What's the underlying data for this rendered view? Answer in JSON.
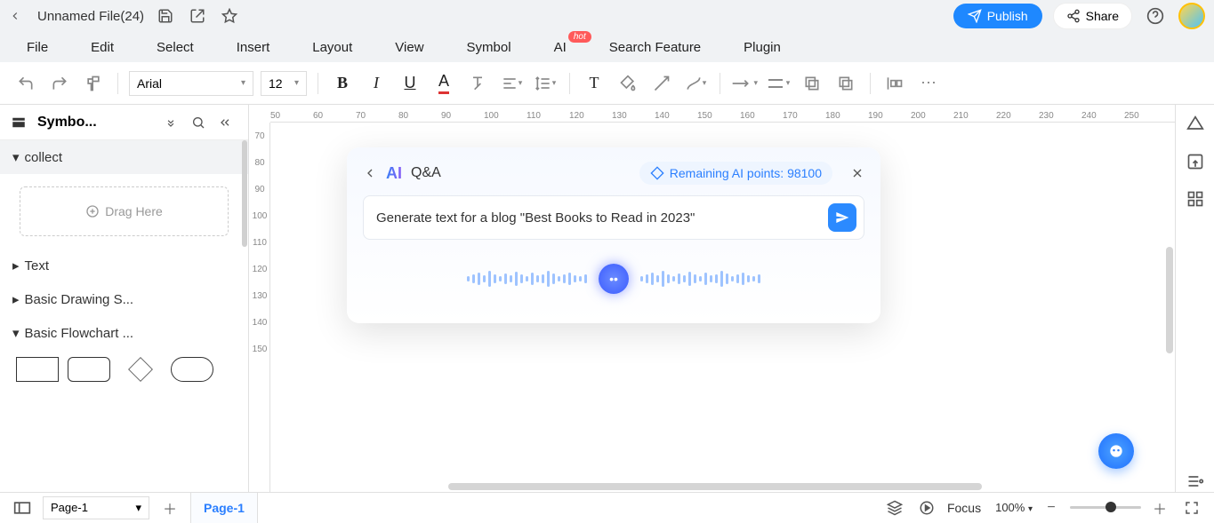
{
  "titlebar": {
    "filename": "Unnamed File(24)",
    "publish": "Publish",
    "share": "Share"
  },
  "menu": {
    "file": "File",
    "edit": "Edit",
    "select": "Select",
    "insert": "Insert",
    "layout": "Layout",
    "view": "View",
    "symbol": "Symbol",
    "ai": "AI",
    "ai_hot": "hot",
    "search": "Search Feature",
    "plugin": "Plugin"
  },
  "toolbar": {
    "font": "Arial",
    "size": "12"
  },
  "sidebar": {
    "title": "Symbo...",
    "sections": {
      "collect": "collect",
      "drag": "Drag Here",
      "text": "Text",
      "basic_drawing": "Basic Drawing S...",
      "basic_flowchart": "Basic Flowchart ..."
    }
  },
  "ruler_h": [
    "50",
    "60",
    "70",
    "80",
    "90",
    "100",
    "110",
    "120",
    "130",
    "140",
    "150",
    "160",
    "170",
    "180",
    "190",
    "200",
    "210",
    "220",
    "230",
    "240",
    "250"
  ],
  "ruler_v": [
    "70",
    "80",
    "90",
    "100",
    "110",
    "120",
    "130",
    "140",
    "150"
  ],
  "ai_panel": {
    "label": "AI",
    "qa": "Q&A",
    "points_label": "Remaining AI points: ",
    "points": "98100",
    "prompt": "Generate text for a blog \"Best Books to Read in 2023\""
  },
  "status": {
    "page_sel": "Page-1",
    "page_tab": "Page-1",
    "focus": "Focus",
    "zoom": "100%"
  }
}
